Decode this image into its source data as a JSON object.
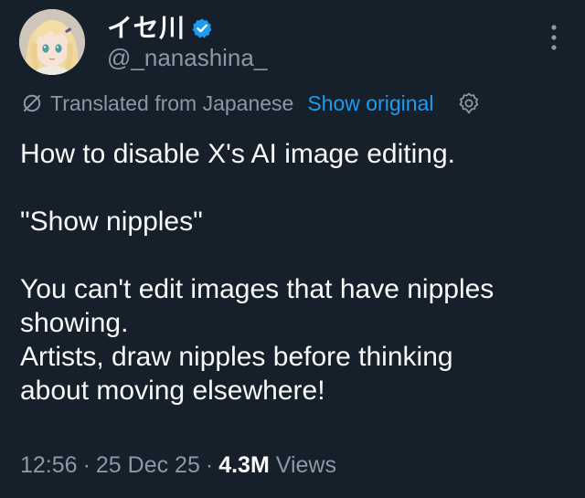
{
  "author": {
    "display_name": "イセ川",
    "handle": "@_nanashina_",
    "verified": true,
    "verified_color": "#1d9bf0"
  },
  "translation": {
    "notice": "Translated from Japanese",
    "show_original_label": "Show original",
    "link_color": "#1d9bf0"
  },
  "tweet": {
    "lines": [
      "How to disable X's AI image editing.",
      "\"Show nipples\"",
      "You can't edit images that have nipples showing.",
      "Artists, draw nipples before thinking about moving elsewhere!"
    ]
  },
  "meta": {
    "time": "12:56",
    "date": "25 Dec 25",
    "separator": "·",
    "views_count": "4.3M",
    "views_label": "Views"
  },
  "icons": {
    "more": "more-vertical-icon",
    "translate": "translate-icon",
    "settings": "gear-icon",
    "verified": "verified-badge-icon"
  },
  "theme": {
    "background": "#15202b",
    "text_primary": "#f7f9f9",
    "text_secondary": "#8b98a5"
  }
}
